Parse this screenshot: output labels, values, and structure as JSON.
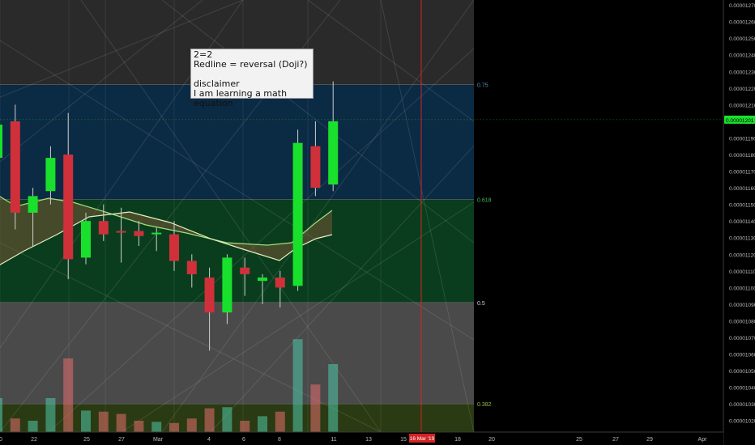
{
  "chart_data": {
    "type": "candlestick",
    "price_axis": {
      "ticks": [
        "0.00001270",
        "0.00001260",
        "0.00001250",
        "0.00001240",
        "0.00001230",
        "0.00001220",
        "0.00001210",
        "0.00001200",
        "0.00001190",
        "0.00001180",
        "0.00001170",
        "0.00001160",
        "0.00001150",
        "0.00001140",
        "0.00001130",
        "0.00001120",
        "0.00001110",
        "0.00001100",
        "0.00001090",
        "0.00001080",
        "0.00001070",
        "0.00001060",
        "0.00001050",
        "0.00001040",
        "0.00001030",
        "0.00001020"
      ],
      "range": [
        1.015e-05,
        1.272e-05
      ],
      "last_price_label": "0.00001201"
    },
    "time_axis": {
      "labels": [
        "0",
        "22",
        "25",
        "27",
        "Mar",
        "4",
        "6",
        "8",
        "11",
        "13",
        "15",
        "18",
        "20",
        "25",
        "27",
        "29",
        "Apr"
      ],
      "highlight_label": "16 Mar '19"
    },
    "fib_levels": [
      {
        "label": "0.75",
        "value": 1.222e-05
      },
      {
        "label": "0.618",
        "value": 1.153e-05
      },
      {
        "label": "0.5",
        "value": 1.091e-05
      },
      {
        "label": "0.382",
        "value": 1.03e-05
      }
    ],
    "candles": [
      {
        "o": 1.178e-05,
        "h": 1.21e-05,
        "l": 1.12e-05,
        "c": 1.198e-05
      },
      {
        "o": 1.2e-05,
        "h": 1.21e-05,
        "l": 1.135e-05,
        "c": 1.145e-05
      },
      {
        "o": 1.145e-05,
        "h": 1.16e-05,
        "l": 1.125e-05,
        "c": 1.155e-05
      },
      {
        "o": 1.158e-05,
        "h": 1.185e-05,
        "l": 1.15e-05,
        "c": 1.178e-05
      },
      {
        "o": 1.18e-05,
        "h": 1.205e-05,
        "l": 1.105e-05,
        "c": 1.117e-05
      },
      {
        "o": 1.118e-05,
        "h": 1.145e-05,
        "l": 1.114e-05,
        "c": 1.14e-05
      },
      {
        "o": 1.14e-05,
        "h": 1.15e-05,
        "l": 1.128e-05,
        "c": 1.132e-05
      },
      {
        "o": 1.134e-05,
        "h": 1.148e-05,
        "l": 1.115e-05,
        "c": 1.133e-05
      },
      {
        "o": 1.134e-05,
        "h": 1.14e-05,
        "l": 1.125e-05,
        "c": 1.131e-05
      },
      {
        "o": 1.132e-05,
        "h": 1.136e-05,
        "l": 1.122e-05,
        "c": 1.133e-05
      },
      {
        "o": 1.132e-05,
        "h": 1.14e-05,
        "l": 1.11e-05,
        "c": 1.116e-05
      },
      {
        "o": 1.116e-05,
        "h": 1.12e-05,
        "l": 1.1e-05,
        "c": 1.108e-05
      },
      {
        "o": 1.106e-05,
        "h": 1.112e-05,
        "l": 1.062e-05,
        "c": 1.085e-05
      },
      {
        "o": 1.085e-05,
        "h": 1.12e-05,
        "l": 1.078e-05,
        "c": 1.118e-05
      },
      {
        "o": 1.112e-05,
        "h": 1.118e-05,
        "l": 1.095e-05,
        "c": 1.108e-05
      },
      {
        "o": 1.104e-05,
        "h": 1.108e-05,
        "l": 1.09e-05,
        "c": 1.106e-05
      },
      {
        "o": 1.106e-05,
        "h": 1.11e-05,
        "l": 1.088e-05,
        "c": 1.1e-05
      },
      {
        "o": 1.101e-05,
        "h": 1.195e-05,
        "l": 1.098e-05,
        "c": 1.187e-05
      },
      {
        "o": 1.185e-05,
        "h": 1.2e-05,
        "l": 1.155e-05,
        "c": 1.16e-05
      },
      {
        "o": 1.162e-05,
        "h": 1.224e-05,
        "l": 1.158e-05,
        "c": 1.2e-05
      }
    ],
    "volumes": [
      0.3,
      0.12,
      0.1,
      0.3,
      0.65,
      0.19,
      0.18,
      0.16,
      0.1,
      0.09,
      0.08,
      0.12,
      0.21,
      0.22,
      0.1,
      0.14,
      0.18,
      0.82,
      0.42,
      0.6
    ]
  },
  "annotation": {
    "line1": "2=2",
    "line2": "Redline = reversal (Doji?)",
    "line3": "disclaimer",
    "line4": "I am learning a math equation"
  },
  "colors": {
    "up": "#19e02d",
    "down": "#d0303a",
    "fib_top": "#2a2a2a",
    "fib_blue": "#0b2a44",
    "fib_green": "#0a3d1d",
    "fib_gray": "#4a4a4a",
    "fib_olive": "#2a3a12",
    "redline": "#d22424",
    "axis_bg": "#000000"
  }
}
